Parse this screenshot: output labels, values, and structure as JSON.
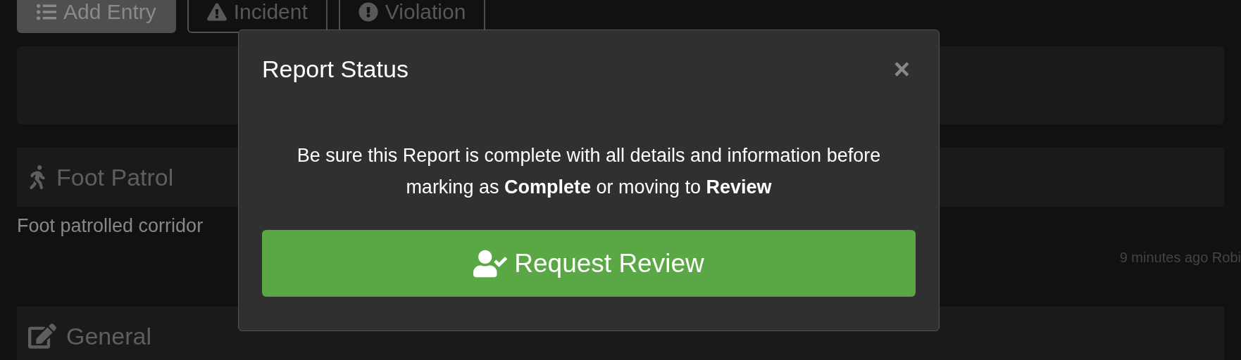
{
  "toolbar": {
    "buttons": [
      {
        "label": "Add Entry",
        "kind": "list",
        "selected": true
      },
      {
        "label": "Incident",
        "kind": "warning",
        "selected": false
      },
      {
        "label": "Violation",
        "kind": "alert",
        "selected": false
      }
    ]
  },
  "entries": [
    {
      "title": "Foot Patrol",
      "kind": "walk",
      "text": "Foot patrolled corridor",
      "meta": "9 minutes ago Robi"
    },
    {
      "title": "General",
      "kind": "edit"
    }
  ],
  "modal": {
    "title": "Report Status",
    "close": "×",
    "message": "Be sure this Report is complete with all details and information before marking as **Complete** or moving to **Review**",
    "action": "Request Review"
  }
}
